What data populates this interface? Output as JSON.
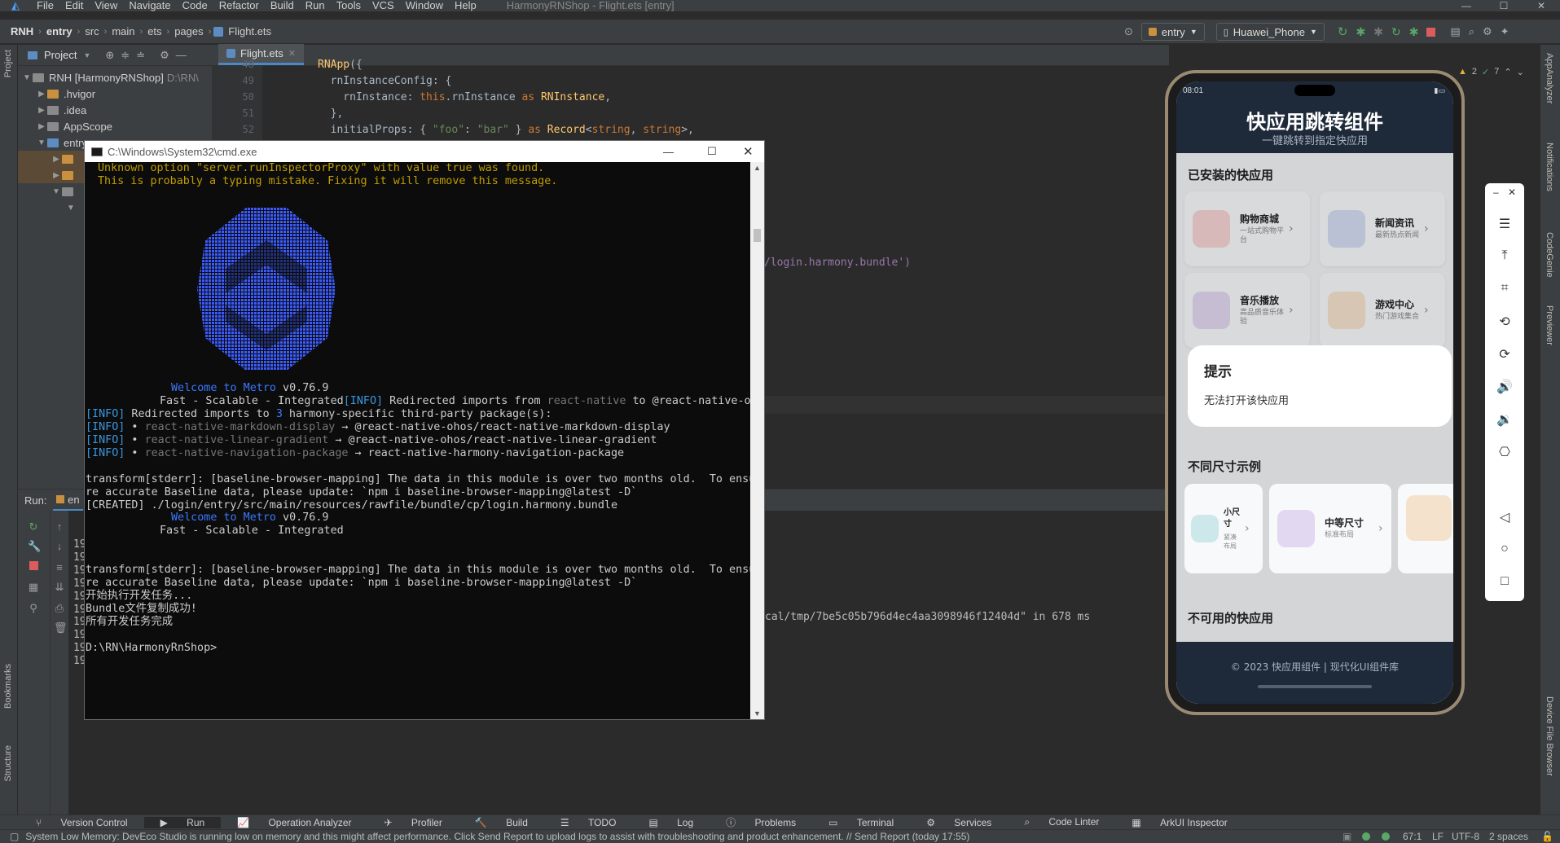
{
  "menubar": {
    "items": [
      "File",
      "Edit",
      "View",
      "Navigate",
      "Code",
      "Refactor",
      "Build",
      "Run",
      "Tools",
      "VCS",
      "Window",
      "Help"
    ],
    "window_title": "HarmonyRNShop - Flight.ets [entry]"
  },
  "navbar": {
    "breadcrumbs": [
      "RNH",
      "entry",
      "src",
      "main",
      "ets",
      "pages",
      "Flight.ets"
    ],
    "module_select": "entry",
    "device_select": "Huawei_Phone"
  },
  "project_panel": {
    "title": "Project",
    "tree": [
      {
        "label": "RNH [HarmonyRNShop]",
        "extra": "D:\\RN\\",
        "depth": 0,
        "open": true
      },
      {
        "label": ".hvigor",
        "depth": 1,
        "open": false
      },
      {
        "label": ".idea",
        "depth": 1,
        "open": false
      },
      {
        "label": "AppScope",
        "depth": 1,
        "open": false
      },
      {
        "label": "entry",
        "depth": 1,
        "open": true
      }
    ]
  },
  "editor": {
    "tab": "Flight.ets",
    "line_numbers": [
      "48",
      "49",
      "50",
      "51",
      "52"
    ],
    "fragment_bundle": "/login.harmony.bundle')"
  },
  "cmd": {
    "title": "C:\\Windows\\System32\\cmd.exe",
    "warn1": "Unknown option \"server.runInspectorProxy\" with value true was found.",
    "warn2": "This is probably a typing mistake. Fixing it will remove this message.",
    "welcome_a": "Welcome to Metro",
    "version": " v0.76.9",
    "tagline": "Fast - Scalable - Integrated",
    "info_tag": "[INFO]",
    "redirect1_a": " Redirected imports from ",
    "redirect1_b": "react-native",
    "redirect1_c": " to @react-native-oh/react-native-harmony",
    "redirect2_a": " Redirected imports to ",
    "redirect2_b": "3",
    "redirect2_c": " harmony-specific third-party package(s):",
    "pkg1_a": "react-native-markdown-display",
    "pkg1_b": " → @react-native-ohos/react-native-markdown-display",
    "pkg2_a": "react-native-linear-gradient",
    "pkg2_b": " → @react-native-ohos/react-native-linear-gradient",
    "pkg3_a": "react-native-navigation-package",
    "pkg3_b": " → react-native-harmony-navigation-package",
    "stderr1": "transform[stderr]: [baseline-browser-mapping] The data in this module is over two months old.  To ensu",
    "stderr2": "re accurate Baseline data, please update: `npm i baseline-browser-mapping@latest -D`",
    "created": "[CREATED] ./login/entry/src/main/resources/rawfile/bundle/cp/login.harmony.bundle",
    "cn1": "开始执行开发任务...",
    "cn2": "Bundle文件复制成功!",
    "cn3": "所有开发任务完成",
    "prompt": "D:\\RN\\HarmonyRnShop>"
  },
  "run_panel": {
    "label": "Run:",
    "tab": "en",
    "log_fragment": "cal/tmp/7be5c05b796d4ec4aa3098946f12404d\" in 678 ms",
    "row_prefix": "19"
  },
  "phone": {
    "status_time": "08:01",
    "header_title": "快应用跳转组件",
    "header_subtitle": "一键跳转到指定快应用",
    "installed_title": "已安装的快应用",
    "apps": [
      {
        "name": "购物商城",
        "desc": "一站式购物平台",
        "color": "#f5d3d3"
      },
      {
        "name": "新闻资讯",
        "desc": "最新热点新闻",
        "color": "#d4dcf3"
      },
      {
        "name": "音乐播放",
        "desc": "高品质音乐体验",
        "color": "#e2d8f1"
      },
      {
        "name": "游戏中心",
        "desc": "热门游戏集合",
        "color": "#f5e2cc"
      }
    ],
    "dialog_title": "提示",
    "dialog_message": "无法打开该快应用",
    "sizes_title": "不同尺寸示例",
    "small": {
      "name": "小尺寸",
      "desc": "紧凑布局"
    },
    "medium": {
      "name": "中等尺寸",
      "desc": "标准布局"
    },
    "unavailable_title": "不可用的快应用",
    "footer": "© 2023 快应用组件 | 现代化UI组件库"
  },
  "notifications": {
    "warnings": "2",
    "ok": "7"
  },
  "bottom_tabs": [
    "Version Control",
    "Run",
    "Operation Analyzer",
    "Profiler",
    "Build",
    "TODO",
    "Log",
    "Problems",
    "Terminal",
    "Services",
    "Code Linter",
    "ArkUI Inspector"
  ],
  "status": {
    "message": "System Low Memory: DevEco Studio is running low on memory and this might affect performance. Click Send Report to upload logs to assist with troubleshooting and product enhancement. // Send Report (today 17:55)",
    "position": "67:1",
    "line_ending": "LF",
    "encoding": "UTF-8",
    "indent": "2 spaces"
  },
  "side_tabs": {
    "left": [
      "Project",
      "Bookmarks",
      "Structure"
    ],
    "right": [
      "AppAnalyzer",
      "Notifications",
      "CodeGenie",
      "Previewer",
      "Device File Browser"
    ]
  }
}
